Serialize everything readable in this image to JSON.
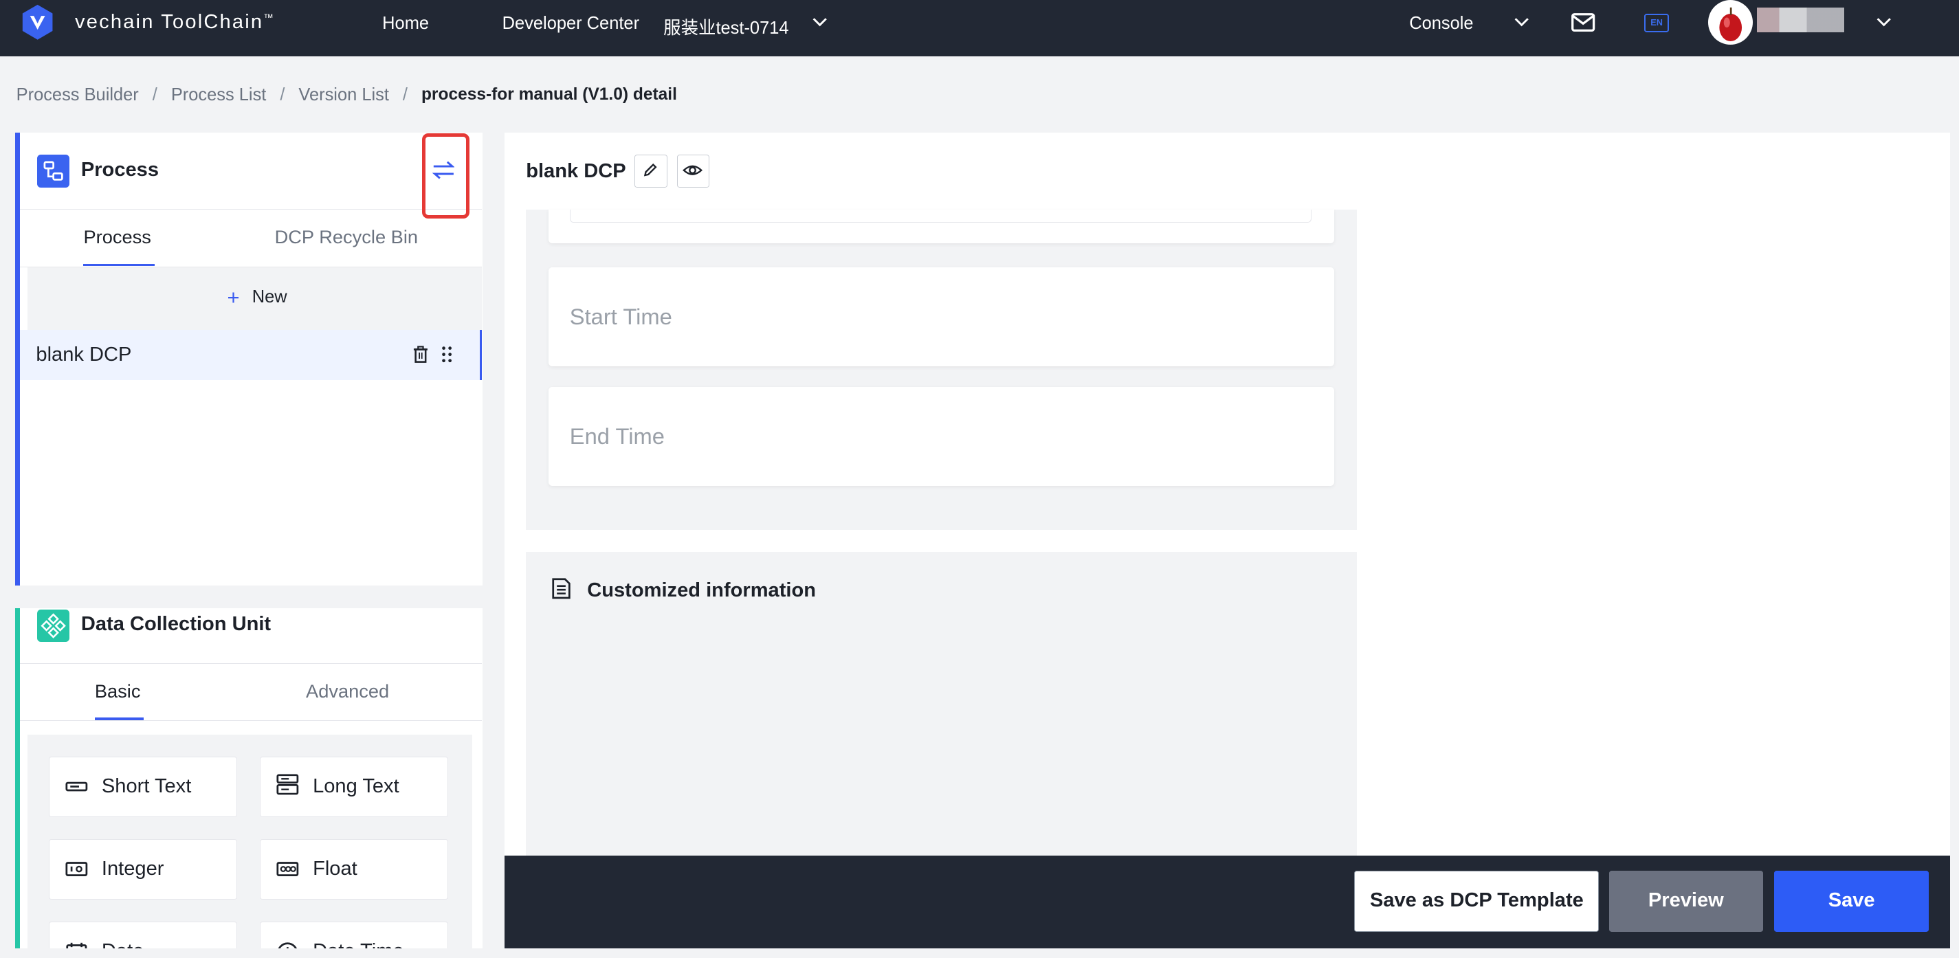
{
  "topbar": {
    "brand": "vechain ToolChain",
    "brand_mark": "™",
    "nav": {
      "home": "Home",
      "developer_center": "Developer Center",
      "workspace": "服装业test-0714",
      "console": "Console"
    },
    "language": "EN"
  },
  "breadcrumb": [
    "Process Builder",
    "Process List",
    "Version List",
    "process-for manual (V1.0) detail"
  ],
  "process_panel": {
    "title": "Process",
    "tabs": [
      "Process",
      "DCP Recycle Bin"
    ],
    "new_label": "New",
    "items": [
      {
        "label": "blank DCP"
      }
    ]
  },
  "dcu_panel": {
    "title": "Data Collection Unit",
    "tabs": [
      "Basic",
      "Advanced"
    ],
    "components": [
      "Short Text",
      "Long Text",
      "Integer",
      "Float",
      "Date",
      "Date Time"
    ]
  },
  "editor": {
    "dcp_title": "blank DCP",
    "fields": [
      "Start Time",
      "End Time"
    ],
    "custom_section_title": "Customized information"
  },
  "footer": {
    "save_template": "Save as DCP Template",
    "preview": "Preview",
    "save": "Save"
  },
  "colors": {
    "primary": "#2d5cf6",
    "teal": "#26c6a6",
    "topbar": "#222834",
    "highlight": "#e53935"
  }
}
